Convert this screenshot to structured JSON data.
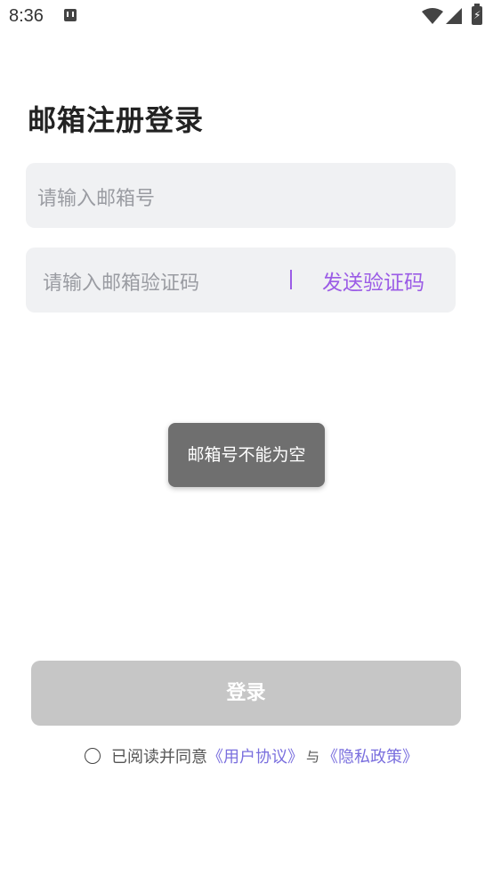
{
  "status_bar": {
    "time": "8:36"
  },
  "page": {
    "title": "邮箱注册登录"
  },
  "form": {
    "email_placeholder": "请输入邮箱号",
    "code_placeholder": "请输入邮箱验证码",
    "send_code_label": "发送验证码"
  },
  "toast": {
    "message": "邮箱号不能为空"
  },
  "login_button": {
    "label": "登录"
  },
  "agreement": {
    "prefix": "已阅读并同意",
    "user_agreement": "《用户协议》",
    "and": "与",
    "privacy_policy": "《隐私政策》"
  },
  "colors": {
    "accent": "#9b5ce6",
    "link": "#7a6fde",
    "field_bg": "#f0f1f3",
    "button_disabled": "#c6c6c6",
    "toast_bg": "#6f6f6f"
  }
}
